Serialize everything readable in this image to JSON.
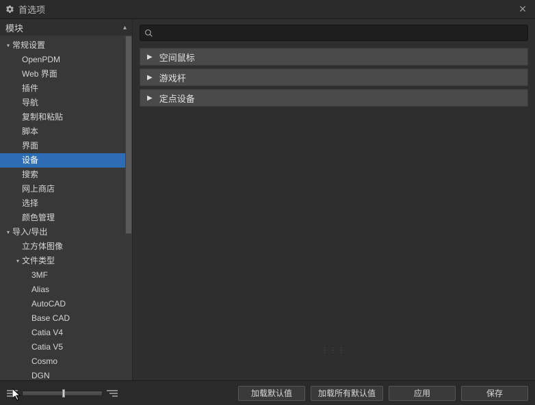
{
  "window": {
    "title": "首选项"
  },
  "sidebar": {
    "header": "模块",
    "tree": [
      {
        "label": "常规设置",
        "indent": 0,
        "twisty": "▾",
        "children": [
          {
            "label": "OpenPDM",
            "indent": 1
          },
          {
            "label": "Web 界面",
            "indent": 1
          },
          {
            "label": "插件",
            "indent": 1
          },
          {
            "label": "导航",
            "indent": 1
          },
          {
            "label": "复制和粘贴",
            "indent": 1
          },
          {
            "label": "脚本",
            "indent": 1
          },
          {
            "label": "界面",
            "indent": 1
          },
          {
            "label": "设备",
            "indent": 1,
            "selected": true
          },
          {
            "label": "搜索",
            "indent": 1
          },
          {
            "label": "网上商店",
            "indent": 1
          },
          {
            "label": "选择",
            "indent": 1
          },
          {
            "label": "颜色管理",
            "indent": 1
          }
        ]
      },
      {
        "label": "导入/导出",
        "indent": 0,
        "twisty": "▾",
        "children": [
          {
            "label": "立方体图像",
            "indent": 1
          },
          {
            "label": "文件类型",
            "indent": 1,
            "twisty": "▾",
            "children": [
              {
                "label": "3MF",
                "indent": 2
              },
              {
                "label": "Alias",
                "indent": 2
              },
              {
                "label": "AutoCAD",
                "indent": 2
              },
              {
                "label": "Base CAD",
                "indent": 2
              },
              {
                "label": "Catia V4",
                "indent": 2
              },
              {
                "label": "Catia V5",
                "indent": 2
              },
              {
                "label": "Cosmo",
                "indent": 2
              },
              {
                "label": "DGN",
                "indent": 2
              }
            ]
          }
        ]
      }
    ]
  },
  "search": {
    "placeholder": ""
  },
  "sections": [
    {
      "label": "空间鼠标"
    },
    {
      "label": "游戏杆"
    },
    {
      "label": "定点设备"
    }
  ],
  "footer": {
    "load_defaults": "加载默认值",
    "load_all_defaults": "加载所有默认值",
    "apply": "应用",
    "save": "保存"
  },
  "colors": {
    "accent": "#2d6db4"
  }
}
